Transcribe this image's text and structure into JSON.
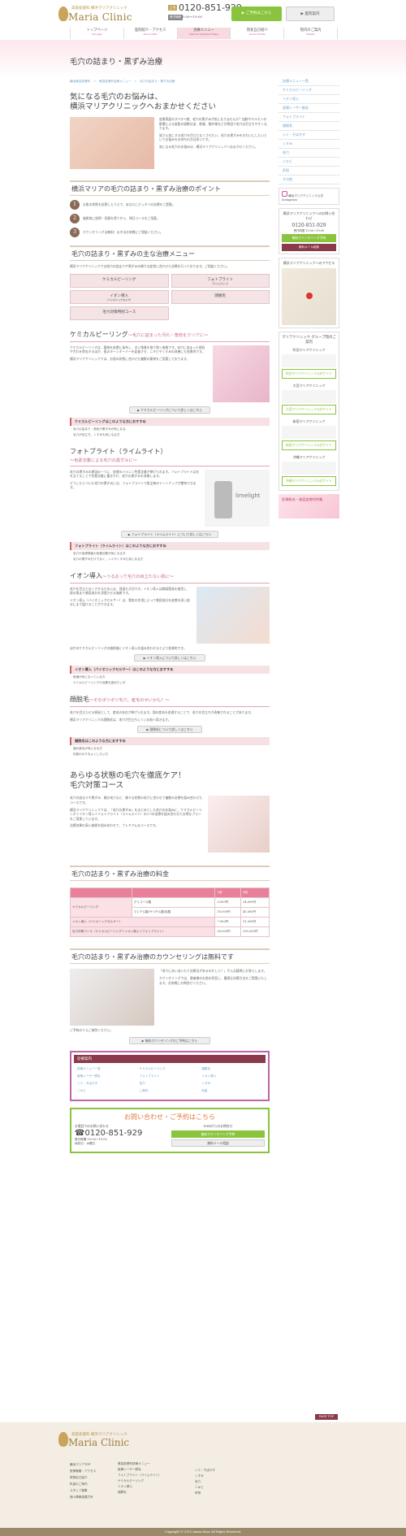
{
  "header": {
    "logo_sub": "美容皮膚科 横浜マリアクリニック",
    "logo": "Maria Clinic",
    "tel_label": "ご予約",
    "tel": "0120-851-929",
    "hours_label": "受付時間",
    "hours": "10:00～19:00",
    "reserve_btn": "ご予約はこちら",
    "clinic_btn": "医院案内"
  },
  "gnav": [
    {
      "label": "トップページ",
      "en": "Top page"
    },
    {
      "label": "医院紹介・アクセス",
      "en": "About Clinic"
    },
    {
      "label": "治療メニュー",
      "en": "Medical Treatment Menu"
    },
    {
      "label": "院長自己紹介",
      "en": "Doctor Profile"
    },
    {
      "label": "院内のご案内",
      "en": "Facility"
    }
  ],
  "hero_title": "毛穴の詰まり・黒ずみ治療",
  "breadcrumb": "横浜美容皮膚科　＞　美容皮膚科治療メニュー　＞　毛穴の詰まり・黒ずみ治療",
  "intro": {
    "title1": "気になる毛穴のお悩みは、",
    "title2": "横浜マリアクリニックへおまかせください",
    "p1": "皮膚表面のすべすべ感、毛穴の黒ずみが気になりませんか？加齢やホルモンの影響による皮脂の過剰分泌、乾燥、紫外線などが原因で毛穴は目立ちやすくなります。",
    "p2": "皆さん気にする毛穴を目立たなくさせたい、毛穴の黒ずみをきれいにしたいというお悩みをお持ちの方は多いです。",
    "p3": "気になる毛穴のお悩みは、横浜マリアクリニックへおまかせください。"
  },
  "points": {
    "title": "横浜マリアの毛穴の詰まり・黒ずみ治療のポイント",
    "items": [
      "お肌の状態を診察したうえで、あなたにピッタリの治療をご提案。",
      "施術前に説明・同意を得てから、明日コースをご用意。",
      "カウンセリングは無料！まずはお気軽にご相談ください。"
    ]
  },
  "menu": {
    "title": "毛穴の詰まり・黒ずみの主な治療メニュー",
    "intro": "横浜マリアクリニックでは毛穴の詰まりや黒ずみの様々な症状に合わせた治療を行っております。ご相談ください。",
    "buttons": [
      {
        "label": "ケミカルピーリング",
        "sub": ""
      },
      {
        "label": "フォトブライト",
        "sub": "（ライムライト）"
      },
      {
        "label": "イオン導入",
        "sub": "（バイオニックセルサ）"
      },
      {
        "label": "顔脱毛",
        "sub": ""
      },
      {
        "label": "毛穴対策特別コース",
        "sub": ""
      }
    ]
  },
  "chemical": {
    "title": "ケミカルピーリング",
    "sub": "～毛穴に詰まった汚れ・角栓をクリアに～",
    "p1": "ケミカルピーリングは、薬剤を皮膚に塗布し、古い角質を取り除く施術です。毛穴に詰まった角栓や汚れを除去するほか、肌のターンオーバーを促進させ、ニキビやくすみの改善にも効果的です。",
    "p2": "横浜マリアクリニックでは、お肌の状態に合わせた複数の薬剤をご用意しております。",
    "button": "ケミカルピーリングについて詳しくはこちら",
    "rec_title": "ケミカルピーリングはこのような方におすすめ",
    "rec": [
      "毛穴の詰まり・角栓や黒ずみが気になる",
      "毛穴が目立ち、くすみも気になる方"
    ]
  },
  "photo": {
    "title": "フォトブライト（ライムライト）",
    "sub": "～色素沈着による毛穴の黒ずみに～",
    "p1": "毛穴の黒ずみの原因の一つに、皮膚のメラニン色素沈着が挙げられます。フォトブライトは光を当てることで色素沈着に働きかけ、毛穴の黒ずみを改善します。",
    "p2": "どうしたらついた毛穴の黒ずみには、フォトブライトで肌全体のトーンアップが期待できます。",
    "logo": "limelight",
    "button": "フォトブライト（ライムライト）について詳しくはこちら",
    "rec_title": "フォトブライト（ライムライト）はこのような方におすすめ",
    "rec": [
      "毛穴や皮膚表面の色素沈着が気になる方",
      "毛穴の黒ずみだけでなく、シミやくすみも気になる方"
    ]
  },
  "ion": {
    "title": "イオン導入",
    "sub": "～うるおって毛穴の目立たない肌に～",
    "p1": "毛穴を目立たなくさせるためには、保湿も大切です。イオン導入は微弱電流を使用し、肌の奥まで美容成分を浸透させる施術です。",
    "p2": "イオン導入（バイオニックセルサー）は、電気の作用によって美容成分を皮膚の深い部分にまで届けることができます。",
    "p3": "ほかのケミカルピーリングの施術後にイオン導入を組み合わせるとより効果的です。",
    "button": "イオン導入について詳しくはこちら",
    "rec_title": "イオン導入（バイオニックセルサー）はこのような方におすすめ",
    "rec": [
      "乾燥が気になっている方",
      "ケミカルピーリングの効果を高めたい方"
    ]
  },
  "hair": {
    "title": "顔脱毛",
    "sub": "～そのポツポツ毛穴、産毛のせいかも？～",
    "p1": "毛穴を目立たせる原因として、産毛の存在が挙げられます。顔の産毛を処理することで、毛穴の目立ちが改善されることがあります。",
    "p2": "横浜マリアクリニックの顔脱毛は、毛穴が目立ちにくいお肌へ導きます。",
    "button": "顔脱毛について詳しくはこちら",
    "rec_title": "顔脱毛はこのような方におすすめ",
    "rec": [
      "顔の産毛が気になる方",
      "化粧ののりをよくしたい方"
    ]
  },
  "special": {
    "title1": "あらゆる状態の毛穴を徹底ケア！",
    "title2": "毛穴対策コース",
    "p1": "毛穴の詰まりや黒ずみ、開き毛穴など、様々な状態の毛穴に合わせて複数の治療を組み合わせたコースです。",
    "p2": "横浜マリアクリニックでは、「毛穴の黒ずみ」をはじめとした毛穴のお悩みに、ケミカルピーリング＋イオン導入＋フォトブライト（ライムライト）の3つの治療を組み合わせたお得なプランをご用意しています。",
    "p3": "治療効果の高い施術を組み合わせて、プレミアムなコースです。"
  },
  "price": {
    "title": "毛穴の詰まり・黒ずみ治療の料金",
    "headers": [
      "",
      "",
      "1回",
      "5回"
    ],
    "rows": [
      [
        "ケミカルピーリング",
        "グリコール酸",
        "5,000円",
        "24,000円"
      ],
      [
        "",
        "マンデル酸/サリチル酸/乳酸",
        "10,000円",
        "45,000円"
      ],
      [
        "イオン導入（バイオニックセルサー）",
        "",
        "7,000円",
        "31,500円"
      ],
      [
        "毛穴対策コース（ケミカルピーリング＋イオン導入＋フォトブライト）",
        "",
        "30,000円",
        "135,000円"
      ]
    ]
  },
  "counsel": {
    "title": "毛穴の詰まり・黒ずみ治療のカウンセリングは無料です",
    "p1": "「毛穴にあいあいもう治療法があるのかしら？」そんな疑問にお答えします。",
    "p2": "カウンセリングでは、患者様のお肌を拝見し、最適な治療方法をご提案いたします。お気軽にお問合せください。",
    "p3": "ご予約のうえご来院ください。",
    "button": "無料カウンセリングのご予約はこちら"
  },
  "treatnav": {
    "title": "診療案内",
    "items": [
      "診療メニュー一覧",
      "ケミカルピーリング",
      "顔脱毛",
      "医療レーザー脱毛",
      "フォトブライト",
      "イオン導入",
      "シミ・そばかす",
      "毛穴",
      "くすみ",
      "ニキビ",
      "ご案内",
      "料金"
    ]
  },
  "contact": {
    "title": "お問い合わせ・ご予約はこちら",
    "tel_label": "お電話でのお問い合わせ",
    "tel": "0120-851-929",
    "hours_label": "受付時間",
    "hours": "10:00～19:00",
    "closed": "休診日：水曜日",
    "web_label": "WEBからのお問合せ",
    "web_btn": "無料カウンセリング予約",
    "mail_btn": "無料メール相談"
  },
  "pagetop": "PAGE TOP",
  "side": {
    "links": [
      "診療メニュー一覧",
      "ケミカルピーリング",
      "イオン導入",
      "医療レーザー脱毛",
      "フォトブライト",
      "顔脱毛",
      "シミ・そばかす",
      "くすみ",
      "毛穴",
      "ニキビ",
      "肝斑",
      "その他"
    ],
    "insta_title": "横浜マリアクリニック公式Instagram",
    "contact_title": "横浜マリアクリニックへのお問い合わせ",
    "tel": "0120-851-929",
    "hours": "受付時間 10:00〜19:00",
    "btn1": "無料カウンセリング予約",
    "btn2": "無料メール相談",
    "access_title": "横浜マリアクリニックへのアクセス",
    "group_title": "マリアクリニック グループ院のご案内",
    "groups": [
      {
        "name": "町田マリアクリニック",
        "btn": "町田マリアクリニック公式サイト"
      },
      {
        "name": "大宮マリアクリニック",
        "btn": "大宮マリアクリニック公式サイト"
      },
      {
        "name": "新宿マリアクリニック",
        "btn": "新宿マリアクリニック公式サイト"
      },
      {
        "name": "沖縄マリアクリニック",
        "btn": "沖縄マリアクリニック公式サイト"
      }
    ],
    "banner": "医療脱毛・美容皮膚科特集"
  },
  "footer": {
    "logo_sub": "美容皮膚科 横浜マリアクリニック",
    "logo": "Maria Clinic",
    "col1": [
      "横浜マリアTOP",
      "医療機器・アクセス",
      "院長自己紹介",
      "料金のご案内",
      "スタッフ募集",
      "個人情報保護方針"
    ],
    "col2": [
      "美容皮膚科診療メニュー",
      "医療レーザー脱毛",
      "フォトブライト（ライムライト）",
      "ケミカルピーリング",
      "イオン導入",
      "顔脱毛"
    ],
    "col3": [
      "シミ・そばかす",
      "くすみ",
      "毛穴",
      "ニキビ",
      "肝斑"
    ],
    "copyright": "Copyright © 2015 maria clinic All Rights Reserved."
  }
}
